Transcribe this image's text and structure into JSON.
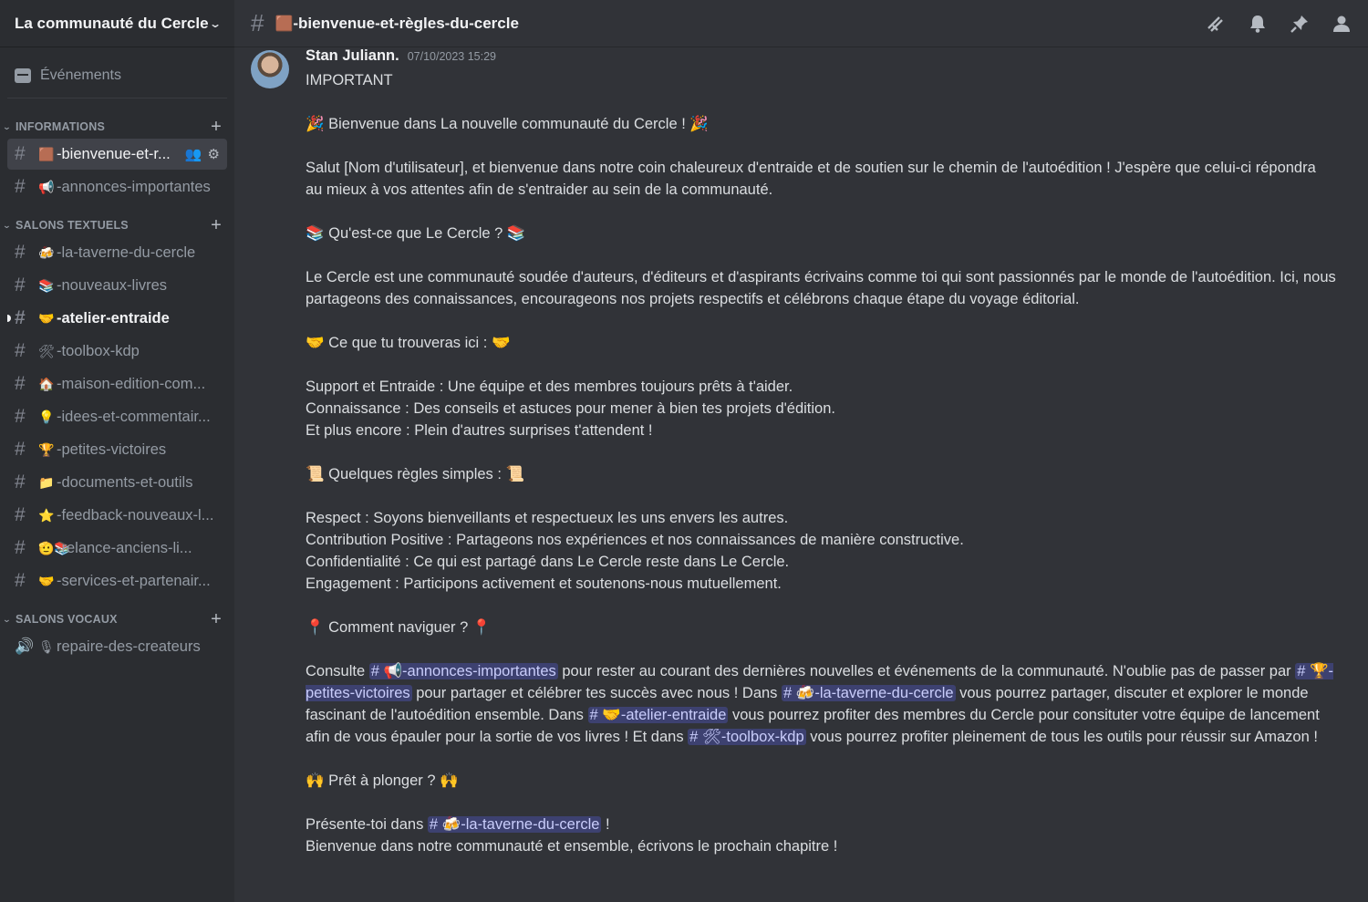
{
  "server": {
    "name": "La communauté du Cercle"
  },
  "events_label": "Événements",
  "categories": [
    {
      "name": "INFORMATIONS",
      "channels": [
        {
          "emoji": "🟫",
          "name": "-bienvenue-et-r...",
          "active": true
        },
        {
          "emoji": "📢",
          "name": "-annonces-importantes"
        }
      ]
    },
    {
      "name": "SALONS TEXTUELS",
      "channels": [
        {
          "emoji": "🍻",
          "name": "-la-taverne-du-cercle"
        },
        {
          "emoji": "📚",
          "name": "-nouveaux-livres"
        },
        {
          "emoji": "🤝",
          "name": "-atelier-entraide",
          "bold": true
        },
        {
          "emoji": "🛠",
          "name": "-toolbox-kdp"
        },
        {
          "emoji": "🏠",
          "name": "-maison-edition-com..."
        },
        {
          "emoji": "💡",
          "name": "-idees-et-commentair..."
        },
        {
          "emoji": "🏆",
          "name": "-petites-victoires"
        },
        {
          "emoji": "📁",
          "name": "-documents-et-outils"
        },
        {
          "emoji": "⭐",
          "name": "-feedback-nouveaux-l..."
        },
        {
          "emoji": "🫡📚",
          "name": "-relance-anciens-li..."
        },
        {
          "emoji": "🤝",
          "name": "-services-et-partenair..."
        }
      ]
    },
    {
      "name": "SALONS VOCAUX",
      "channels": [
        {
          "emoji": "🎙",
          "name": "repaire-des-createurs",
          "voice": true
        }
      ]
    }
  ],
  "topbar": {
    "emoji": "🟫",
    "channel": "-bienvenue-et-règles-du-cercle",
    "icons": [
      "threads-icon",
      "bell-icon",
      "pin-icon",
      "members-icon"
    ]
  },
  "message": {
    "author": "Stan Juliann.",
    "timestamp": "07/10/2023 15:29",
    "blocks": [
      [
        "IMPORTANT"
      ],
      [
        "🎉 Bienvenue dans La nouvelle communauté du Cercle ! 🎉"
      ],
      [
        "Salut [Nom d'utilisateur], et bienvenue dans notre coin chaleureux d'entraide et de soutien sur le chemin de l'autoédition ! J'espère que celui-ci répondra au mieux à vos attentes afin de s'entraider au sein de la communauté."
      ],
      [
        "📚 Qu'est-ce que Le Cercle ? 📚"
      ],
      [
        "Le Cercle est une communauté soudée d'auteurs, d'éditeurs et d'aspirants écrivains comme toi qui sont passionnés par le monde de l'autoédition. Ici, nous partageons des connaissances, encourageons nos projets respectifs et célébrons chaque étape du voyage éditorial."
      ],
      [
        "🤝 Ce que tu trouveras ici : 🤝"
      ],
      [
        "Support et Entraide : Une équipe et des membres toujours prêts à t'aider.",
        "Connaissance : Des conseils et astuces pour mener à bien tes projets d'édition.",
        "Et plus encore : Plein d'autres surprises t'attendent !"
      ],
      [
        "📜 Quelques règles simples : 📜"
      ],
      [
        "Respect : Soyons bienveillants et respectueux les uns envers les autres.",
        "Contribution Positive : Partageons nos expériences et nos connaissances de manière constructive.",
        "Confidentialité : Ce qui est partagé dans Le Cercle reste dans Le Cercle.",
        "Engagement : Participons activement et soutenons-nous mutuellement."
      ],
      [
        "📍 Comment naviguer ? 📍"
      ]
    ],
    "navigate": {
      "t1": "Consulte ",
      "m1": "# 📢-annonces-importantes",
      "t2": " pour rester au courant des dernières nouvelles et événements de la communauté. N'oublie pas de passer par ",
      "m2": "# 🏆-petites-victoires",
      "t3": " pour partager et célébrer tes succès avec nous ! Dans ",
      "m3": "# 🍻-la-taverne-du-cercle",
      "t4": " vous pourrez partager, discuter et explorer le monde fascinant de l'autoédition ensemble. Dans ",
      "m4": "# 🤝-atelier-entraide",
      "t5": " vous pourrez profiter des membres du Cercle pour consituter votre équipe de lancement afin de vous épauler pour la sortie de vos livres ! Et dans ",
      "m5": "# 🛠-toolbox-kdp",
      "t6": " vous pourrez profiter pleinement de tous les outils pour réussir sur Amazon !"
    },
    "ready": "🙌 Prêt à plonger ? 🙌",
    "present": {
      "t1": "Présente-toi dans ",
      "m1": "# 🍻-la-taverne-du-cercle",
      "t2": " !"
    },
    "closing": "Bienvenue dans notre communauté et ensemble, écrivons le prochain chapitre !"
  }
}
